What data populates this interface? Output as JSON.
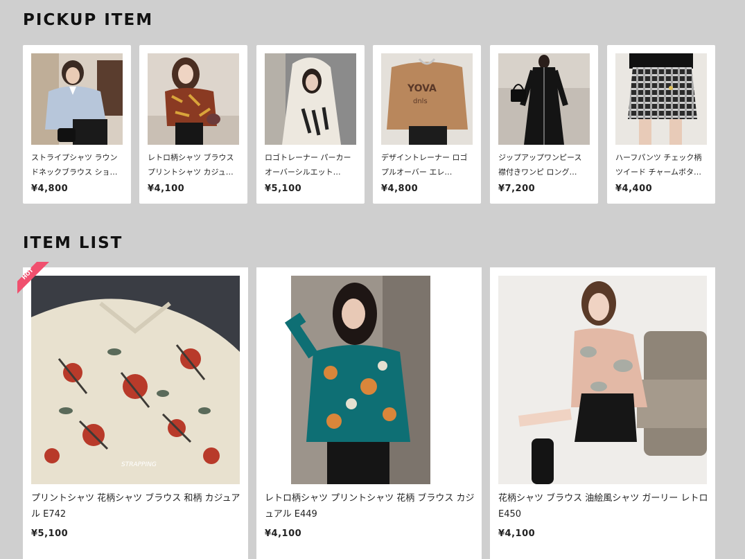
{
  "pickup": {
    "title": "PICKUP ITEM",
    "items": [
      {
        "name": "ストライプシャツ ラウンドネックブラウス ショ…",
        "price": "¥4,800"
      },
      {
        "name": "レトロ柄シャツ ブラウス プリントシャツ カジュ…",
        "price": "¥4,100"
      },
      {
        "name": "ロゴトレーナー パーカー オーバーシルエット…",
        "price": "¥5,100"
      },
      {
        "name": "デザイントレーナー ロゴプルオーバー エレ…",
        "price": "¥4,800"
      },
      {
        "name": "ジップアップワンピース 襟付きワンピ ロング…",
        "price": "¥7,200"
      },
      {
        "name": "ハーフパンツ チェック柄 ツイード チャームボタ…",
        "price": "¥4,400"
      }
    ]
  },
  "item_list": {
    "title": "ITEM LIST",
    "hot_label": "HOT",
    "items": [
      {
        "name": "プリントシャツ 花柄シャツ ブラウス 和柄 カジュアル E742",
        "price": "¥5,100"
      },
      {
        "name": "レトロ柄シャツ プリントシャツ 花柄 ブラウス カジュアル E449",
        "price": "¥4,100"
      },
      {
        "name": "花柄シャツ ブラウス 油絵風シャツ ガーリー レトロ E450",
        "price": "¥4,100"
      }
    ]
  },
  "colors": {
    "background": "#cfcfcf",
    "card": "#ffffff",
    "hot_ribbon": "#f0506e"
  }
}
